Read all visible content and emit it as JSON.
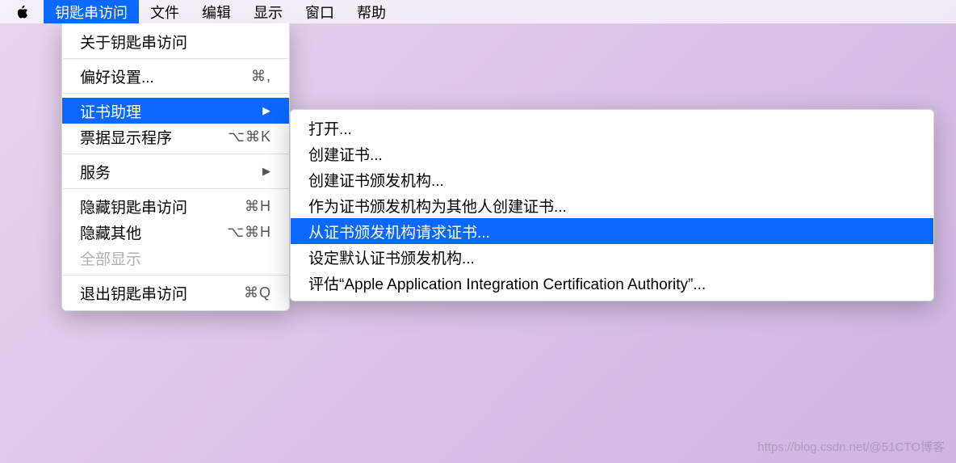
{
  "menubar": {
    "items": [
      {
        "label": "钥匙串访问",
        "active": true
      },
      {
        "label": "文件"
      },
      {
        "label": "编辑"
      },
      {
        "label": "显示"
      },
      {
        "label": "窗口"
      },
      {
        "label": "帮助"
      }
    ]
  },
  "dropdown": {
    "items": [
      {
        "label": "关于钥匙串访问"
      },
      {
        "sep": true
      },
      {
        "label": "偏好设置...",
        "shortcut": "⌘,"
      },
      {
        "sep": true
      },
      {
        "label": "证书助理",
        "submenu": true,
        "highlighted": true
      },
      {
        "label": "票据显示程序",
        "shortcut": "⌥⌘K"
      },
      {
        "sep": true
      },
      {
        "label": "服务",
        "submenu": true
      },
      {
        "sep": true
      },
      {
        "label": "隐藏钥匙串访问",
        "shortcut": "⌘H"
      },
      {
        "label": "隐藏其他",
        "shortcut": "⌥⌘H"
      },
      {
        "label": "全部显示",
        "disabled": true
      },
      {
        "sep": true
      },
      {
        "label": "退出钥匙串访问",
        "shortcut": "⌘Q"
      }
    ]
  },
  "submenu": {
    "items": [
      {
        "label": "打开..."
      },
      {
        "label": "创建证书..."
      },
      {
        "label": "创建证书颁发机构..."
      },
      {
        "label": "作为证书颁发机构为其他人创建证书..."
      },
      {
        "label": "从证书颁发机构请求证书...",
        "highlighted": true
      },
      {
        "label": "设定默认证书颁发机构..."
      },
      {
        "label": "评估“Apple Application Integration Certification Authority”..."
      }
    ]
  },
  "watermark": "https://blog.csdn.net/@51CTO博客"
}
